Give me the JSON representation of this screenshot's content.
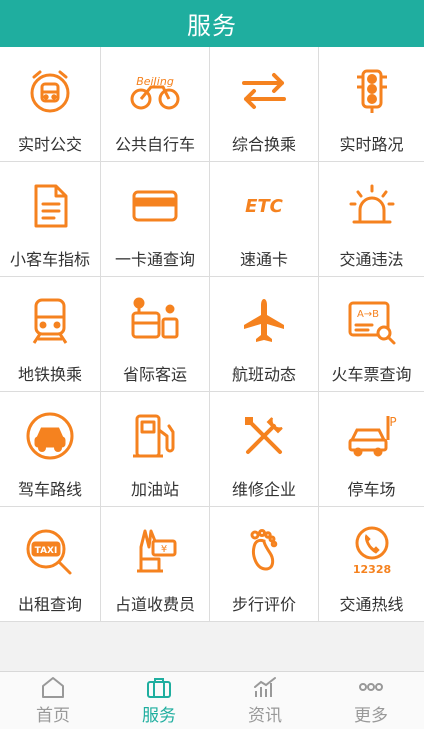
{
  "header": {
    "title": "服务"
  },
  "grid": {
    "items": [
      {
        "label": "实时公交",
        "icon": "bus-clock-icon"
      },
      {
        "label": "公共自行车",
        "icon": "beijing-bike-icon"
      },
      {
        "label": "综合换乘",
        "icon": "transfer-arrows-icon"
      },
      {
        "label": "实时路况",
        "icon": "traffic-light-icon"
      },
      {
        "label": "小客车指标",
        "icon": "document-icon"
      },
      {
        "label": "一卡通查询",
        "icon": "card-icon"
      },
      {
        "label": "速通卡",
        "icon": "etc-icon",
        "icon_text": "ETC"
      },
      {
        "label": "交通违法",
        "icon": "siren-icon"
      },
      {
        "label": "地铁换乘",
        "icon": "subway-icon"
      },
      {
        "label": "省际客运",
        "icon": "coach-bus-icon"
      },
      {
        "label": "航班动态",
        "icon": "airplane-icon"
      },
      {
        "label": "火车票查询",
        "icon": "ticket-search-icon",
        "icon_text": "A→B"
      },
      {
        "label": "驾车路线",
        "icon": "car-icon"
      },
      {
        "label": "加油站",
        "icon": "fuel-pump-icon"
      },
      {
        "label": "维修企业",
        "icon": "wrench-screwdriver-icon"
      },
      {
        "label": "停车场",
        "icon": "parking-car-icon",
        "icon_text": "P"
      },
      {
        "label": "出租查询",
        "icon": "taxi-search-icon",
        "icon_text": "TAXI"
      },
      {
        "label": "占道收费员",
        "icon": "hand-money-icon",
        "icon_text": "¥"
      },
      {
        "label": "步行评价",
        "icon": "footprint-icon"
      },
      {
        "label": "交通热线",
        "icon": "hotline-phone-icon",
        "icon_text": "12328"
      }
    ]
  },
  "tabbar": {
    "tabs": [
      {
        "label": "首页",
        "icon": "home-icon",
        "active": false
      },
      {
        "label": "服务",
        "icon": "briefcase-icon",
        "active": true
      },
      {
        "label": "资讯",
        "icon": "chart-icon",
        "active": false
      },
      {
        "label": "更多",
        "icon": "more-dots-icon",
        "active": false
      }
    ]
  },
  "colors": {
    "accent": "#1fae9f",
    "icon": "#f5821f",
    "inactive": "#999999"
  }
}
